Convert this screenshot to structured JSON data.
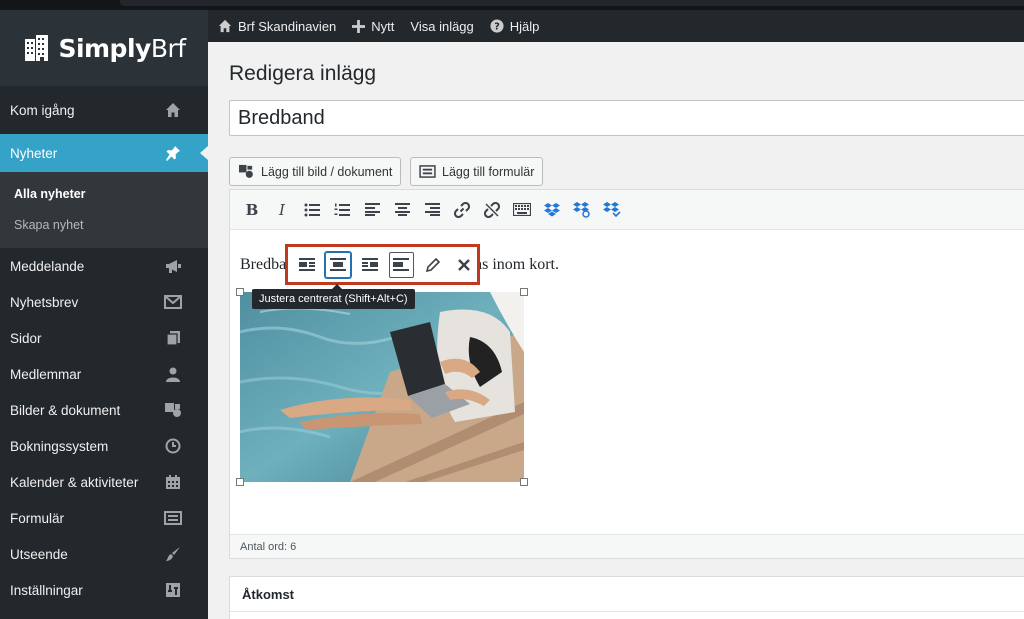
{
  "brand": {
    "name_bold": "Simply",
    "name_light": "Brf"
  },
  "colors": {
    "sidebar_bg": "#23282d",
    "active": "#35a3c8",
    "highlight_box": "#c0391f",
    "selected_button": "#2271b1"
  },
  "sidebar": {
    "items": [
      {
        "label": "Kom igång",
        "icon": "home-icon"
      },
      {
        "label": "Nyheter",
        "icon": "pin-icon",
        "active": true
      },
      {
        "label": "Meddelande",
        "icon": "megaphone-icon"
      },
      {
        "label": "Nyhetsbrev",
        "icon": "envelope-icon"
      },
      {
        "label": "Sidor",
        "icon": "pages-icon"
      },
      {
        "label": "Medlemmar",
        "icon": "user-icon"
      },
      {
        "label": "Bilder & dokument",
        "icon": "media-icon"
      },
      {
        "label": "Bokningssystem",
        "icon": "clock-icon"
      },
      {
        "label": "Kalender & aktiviteter",
        "icon": "calendar-icon"
      },
      {
        "label": "Formulär",
        "icon": "form-icon"
      },
      {
        "label": "Utseende",
        "icon": "brush-icon"
      },
      {
        "label": "Inställningar",
        "icon": "settings-icon"
      }
    ],
    "submenu": [
      {
        "label": "Alla nyheter",
        "current": true
      },
      {
        "label": "Skapa nyhet",
        "current": false
      }
    ]
  },
  "adminbar": {
    "site": "Brf Skandinavien",
    "new": "Nytt",
    "view": "Visa inlägg",
    "help": "Hjälp"
  },
  "page": {
    "title": "Redigera inlägg",
    "post_title": "Bredband",
    "add_media": "Lägg till bild / dokument",
    "add_form": "Lägg till formulär",
    "paragraph_start": "Bredba",
    "paragraph_end": "as inom kort.",
    "tooltip": "Justera centrerat (Shift+Alt+C)",
    "word_count": "Antal ord: 6",
    "access_title": "Åtkomst"
  }
}
